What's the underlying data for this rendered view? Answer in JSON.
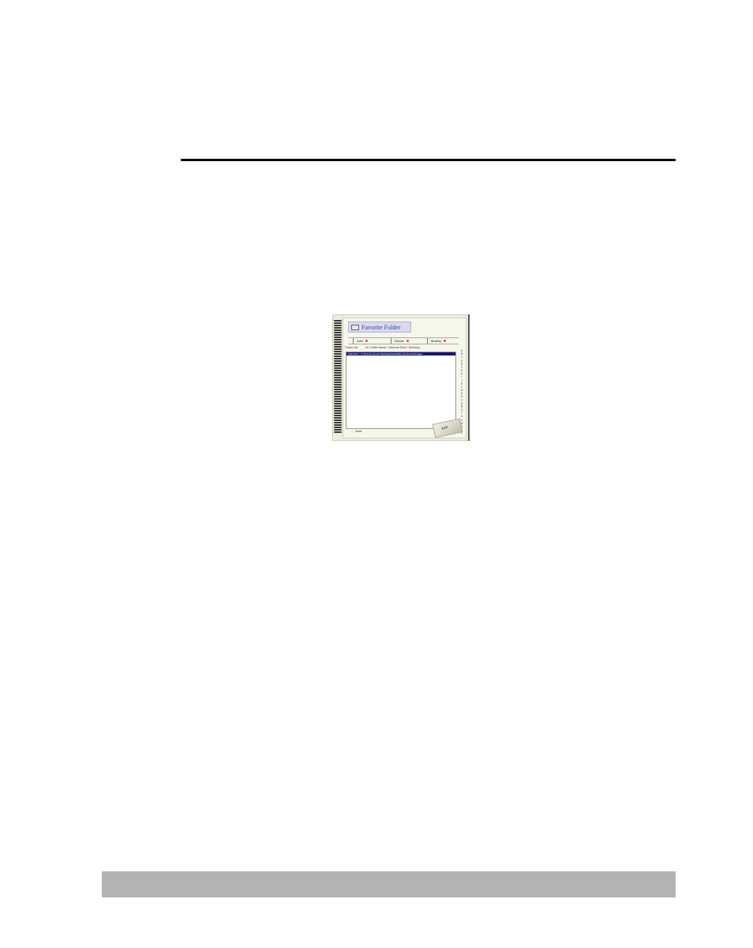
{
  "document": {
    "header_rule_color": "#000000",
    "footer_bar_color": "#b3b3b3"
  },
  "app": {
    "title": "Favorite Folder",
    "toolbar": {
      "add_label": "Add",
      "delete_label": "Delete",
      "modify_label": "Modify"
    },
    "columns": {
      "folder_list": "Folder List",
      "detail": "ex. Folder Name > Network Drive / Directory"
    },
    "list": {
      "rows": [
        {
          "text": "MyFolder > C:\\Documents and Settings\\Default\\My Documents\\Images"
        }
      ],
      "selected_color": "#16157c"
    },
    "alphabet": [
      "A",
      "B",
      "C",
      "D",
      "E",
      "F",
      "G",
      "H",
      "I",
      "J",
      "K",
      "L",
      "M",
      "N",
      "O",
      "P",
      "Q",
      "R",
      "S",
      "T",
      "U",
      "V",
      "W",
      "X",
      "Y",
      "Z"
    ],
    "back_label": "Back",
    "exit_label": "Exit"
  }
}
